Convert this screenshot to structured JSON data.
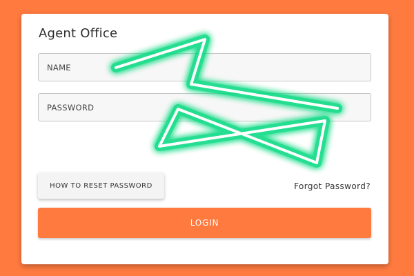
{
  "colors": {
    "background": "#ff7a3f",
    "card": "#ffffff",
    "primary_button": "#ff7a3f",
    "arrow_glow": "#00e68a"
  },
  "login_card": {
    "title": "Agent Office",
    "name_field": {
      "placeholder": "NAME",
      "value": ""
    },
    "password_field": {
      "placeholder": "PASSWORD",
      "value": ""
    },
    "reset_button_label": "HOW TO RESET PASSWORD",
    "forgot_link_label": "Forgot Password?",
    "login_button_label": "LOGIN"
  },
  "overlay": {
    "icon": "neon-arrow-icon"
  }
}
